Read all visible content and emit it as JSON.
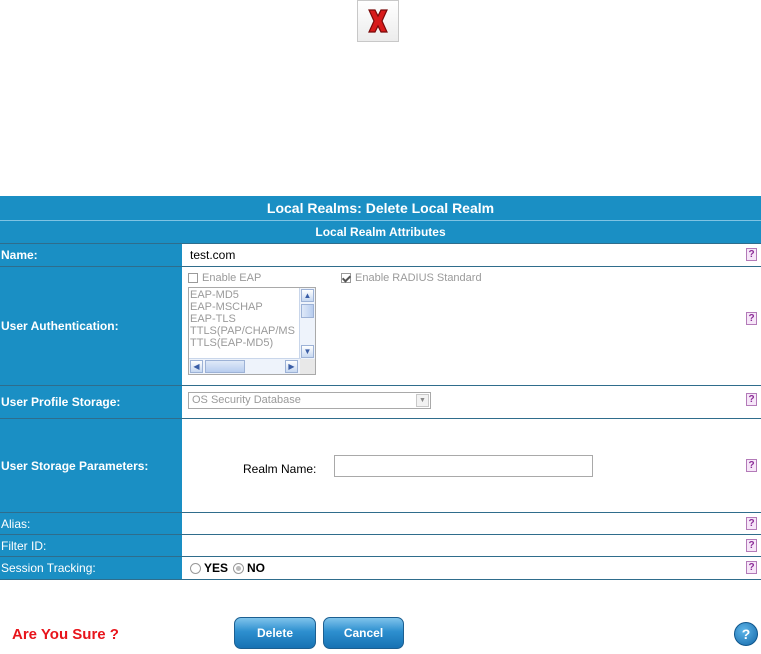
{
  "panel": {
    "title": "Local Realms: Delete Local Realm",
    "subtitle": "Local Realm Attributes"
  },
  "help_marker": "?",
  "fields": {
    "name": {
      "label": "Name:",
      "value": "test.com"
    },
    "user_auth": {
      "label": "User Authentication:",
      "enable_eap": "Enable EAP",
      "enable_eap_checked": false,
      "enable_radius": "Enable RADIUS Standard",
      "enable_radius_checked": true,
      "eap_methods": [
        "EAP-MD5",
        "EAP-MSCHAP",
        "EAP-TLS",
        "TTLS(PAP/CHAP/MS",
        "TTLS(EAP-MD5)"
      ]
    },
    "profile_storage": {
      "label": "User Profile Storage:",
      "value": "OS Security Database"
    },
    "storage_params": {
      "label": "User Storage Parameters:",
      "realm_name_label": "Realm Name:",
      "realm_name_value": ""
    },
    "alias": {
      "label": "Alias:",
      "value": ""
    },
    "filter_id": {
      "label": "Filter ID:",
      "value": ""
    },
    "session_tracking": {
      "label": "Session Tracking:",
      "yes": "YES",
      "no": "NO",
      "selected": "NO"
    }
  },
  "footer": {
    "confirm_text": "Are You Sure ?",
    "delete_label": "Delete",
    "cancel_label": "Cancel",
    "help_label": "?"
  },
  "colors": {
    "header_blue": "#1a8fc4",
    "confirm_red": "#e8141b",
    "close_red": "#d81b1b"
  }
}
